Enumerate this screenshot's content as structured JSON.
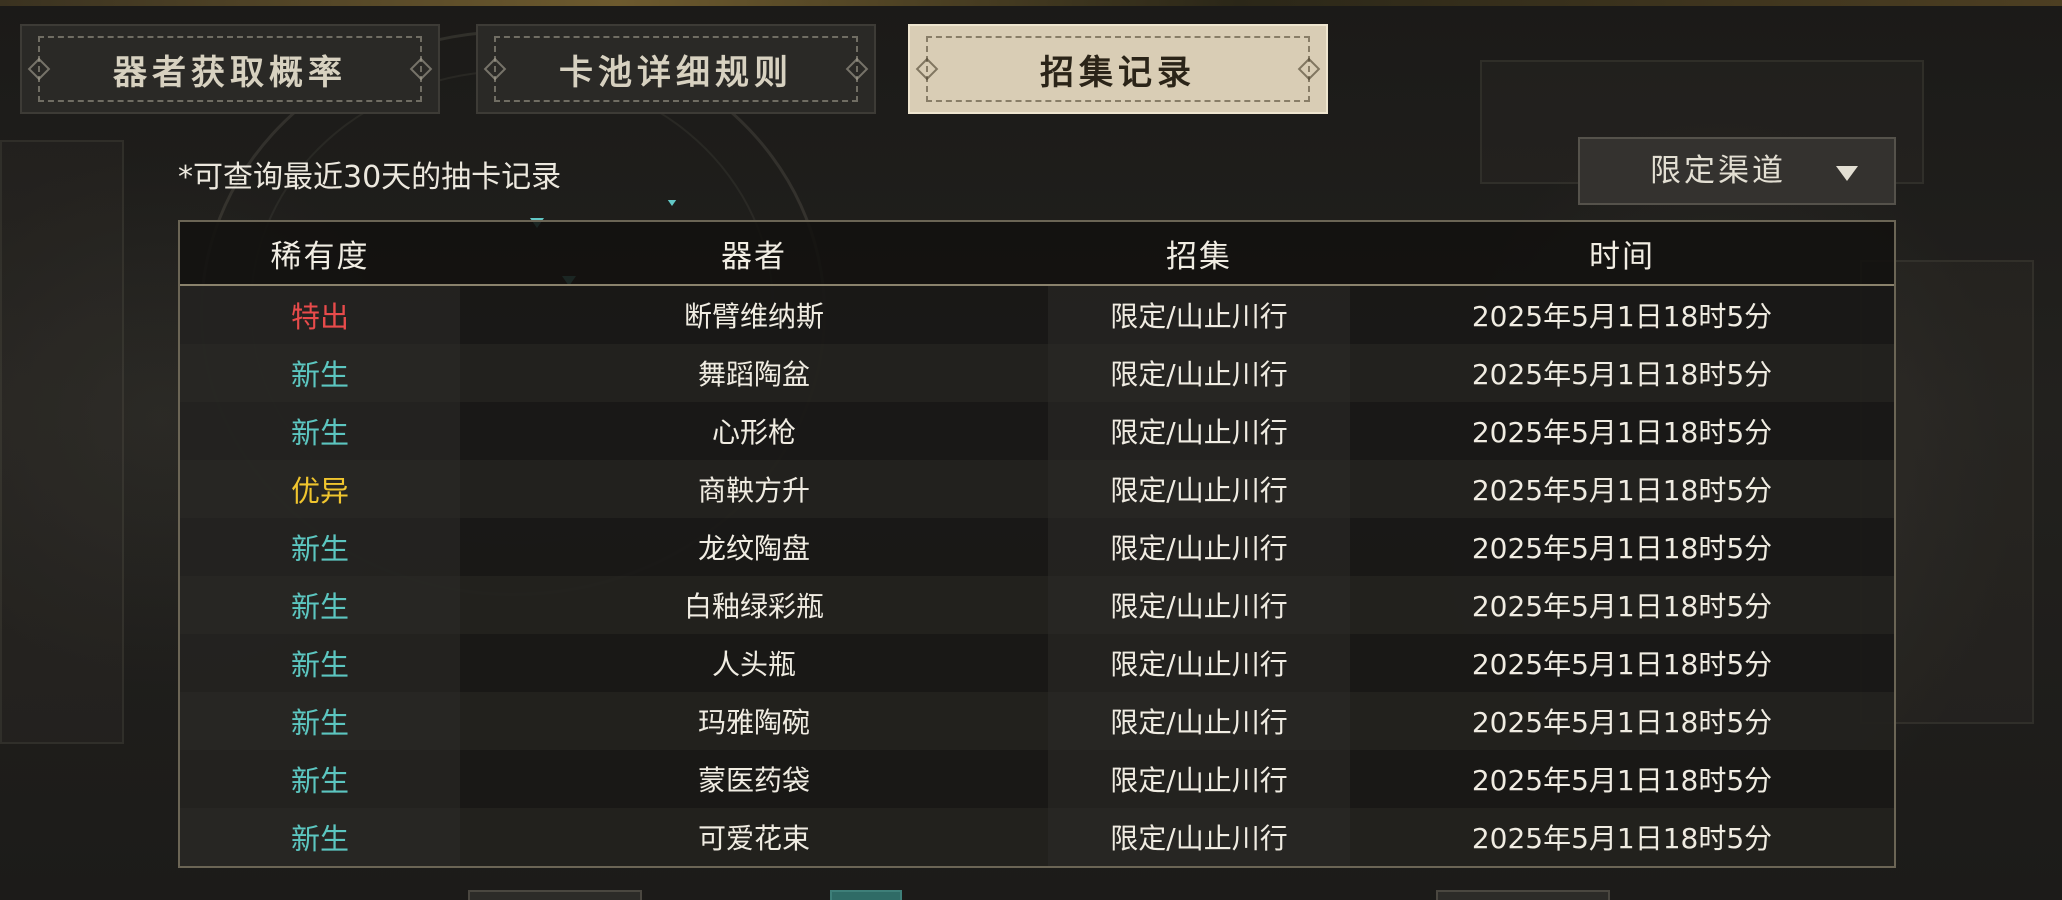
{
  "tabs": [
    {
      "label": "器者获取概率",
      "active": false
    },
    {
      "label": "卡池详细规则",
      "active": false
    },
    {
      "label": "招集记录",
      "active": true
    }
  ],
  "note": "*可查询最近30天的抽卡记录",
  "filter": {
    "selected": "限定渠道",
    "icon": "triangle-down-icon"
  },
  "table": {
    "headers": [
      "稀有度",
      "器者",
      "招集",
      "时间"
    ],
    "rows": [
      {
        "rarity": "特出",
        "rarity_color": "#e84b4b",
        "name": "断臂维纳斯",
        "pool": "限定/山止川行",
        "time": "2025年5月1日18时5分"
      },
      {
        "rarity": "新生",
        "rarity_color": "#5cc6c0",
        "name": "舞蹈陶盆",
        "pool": "限定/山止川行",
        "time": "2025年5月1日18时5分"
      },
      {
        "rarity": "新生",
        "rarity_color": "#5cc6c0",
        "name": "心形枪",
        "pool": "限定/山止川行",
        "time": "2025年5月1日18时5分"
      },
      {
        "rarity": "优异",
        "rarity_color": "#f0c52e",
        "name": "商鞅方升",
        "pool": "限定/山止川行",
        "time": "2025年5月1日18时5分"
      },
      {
        "rarity": "新生",
        "rarity_color": "#5cc6c0",
        "name": "龙纹陶盘",
        "pool": "限定/山止川行",
        "time": "2025年5月1日18时5分"
      },
      {
        "rarity": "新生",
        "rarity_color": "#5cc6c0",
        "name": "白釉绿彩瓶",
        "pool": "限定/山止川行",
        "time": "2025年5月1日18时5分"
      },
      {
        "rarity": "新生",
        "rarity_color": "#5cc6c0",
        "name": "人头瓶",
        "pool": "限定/山止川行",
        "time": "2025年5月1日18时5分"
      },
      {
        "rarity": "新生",
        "rarity_color": "#5cc6c0",
        "name": "玛雅陶碗",
        "pool": "限定/山止川行",
        "time": "2025年5月1日18时5分"
      },
      {
        "rarity": "新生",
        "rarity_color": "#5cc6c0",
        "name": "蒙医药袋",
        "pool": "限定/山止川行",
        "time": "2025年5月1日18时5分"
      },
      {
        "rarity": "新生",
        "rarity_color": "#5cc6c0",
        "name": "可爱花束",
        "pool": "限定/山止川行",
        "time": "2025年5月1日18时5分"
      }
    ]
  }
}
